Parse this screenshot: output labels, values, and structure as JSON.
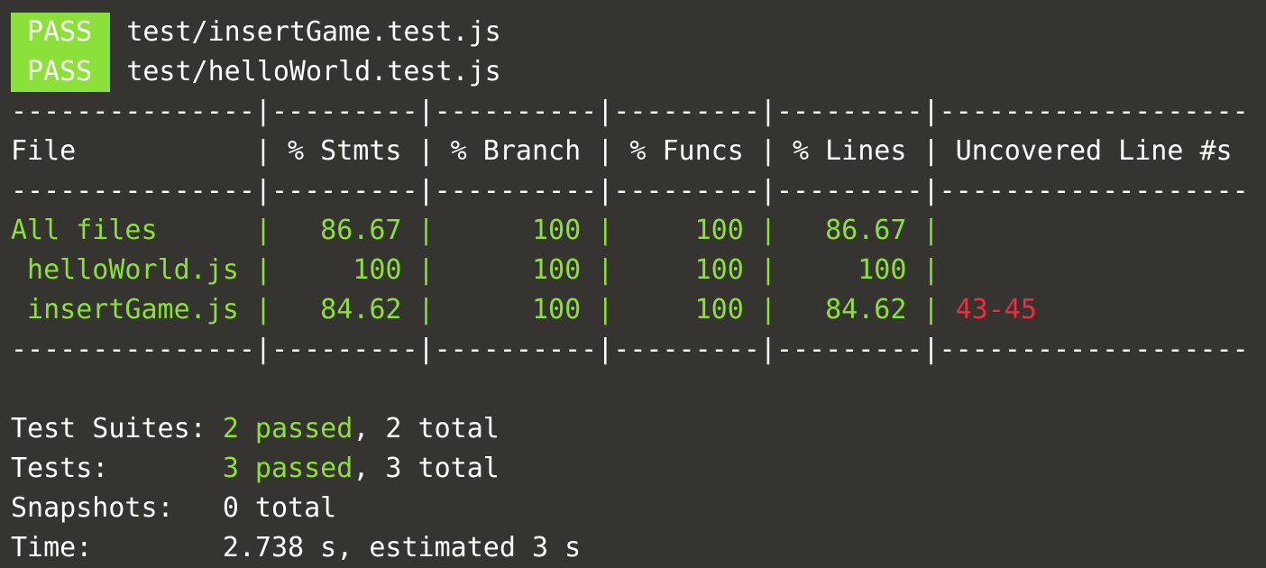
{
  "test_results": [
    {
      "status": "PASS",
      "path": "test/insertGame.test.js"
    },
    {
      "status": "PASS",
      "path": "test/helloWorld.test.js"
    }
  ],
  "coverage_table": {
    "divider": "---------------|---------|----------|---------|---------|-------------------",
    "header": "File           | % Stmts | % Branch | % Funcs | % Lines | Uncovered Line #s",
    "rows": [
      {
        "file": "All files      ",
        "cells": "|   86.67 |      100 |     100 |   86.67 |",
        "uncovered": ""
      },
      {
        "file": " helloWorld.js ",
        "cells": "|     100 |      100 |     100 |     100 |",
        "uncovered": ""
      },
      {
        "file": " insertGame.js ",
        "cells": "|   84.62 |      100 |     100 |   84.62 |",
        "uncovered": "43-45"
      }
    ]
  },
  "summary": {
    "suites_label": "Test Suites: ",
    "suites_passed": "2 passed",
    "suites_total": ", 2 total",
    "tests_label": "Tests:       ",
    "tests_passed": "3 passed",
    "tests_total": ", 3 total",
    "snapshots_label": "Snapshots:   ",
    "snapshots_value": "0 total",
    "time_label": "Time:        ",
    "time_value": "2.738 s, estimated 3 s"
  },
  "colors": {
    "background": "#353431",
    "pass_badge": "#8ce03a",
    "success_text": "#8ce03a",
    "error_text": "#ef2b3c",
    "default_text": "#ffffff"
  }
}
